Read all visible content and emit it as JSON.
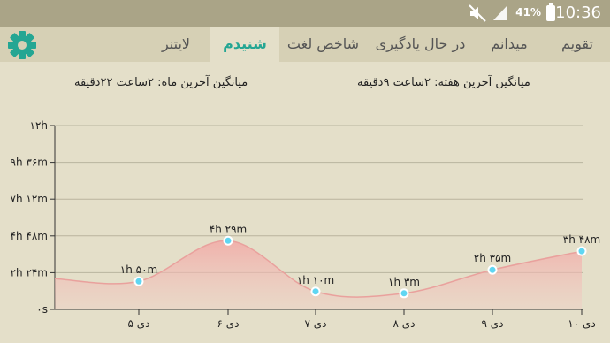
{
  "status": {
    "time": "10:36",
    "battery": "41%",
    "icons": [
      "mute-icon",
      "signal-icon",
      "battery-icon"
    ]
  },
  "tabs": [
    {
      "label": "تقویم",
      "active": false
    },
    {
      "label": "میدانم",
      "active": false
    },
    {
      "label": "در حال یادگیری",
      "active": false
    },
    {
      "label": "شاخص لغت",
      "active": false
    },
    {
      "label": "شنیدم",
      "active": true
    },
    {
      "label": "لایتنر",
      "active": false
    }
  ],
  "settings_icon": "gear-icon",
  "summary": {
    "week": "میانگین آخرین هفته: ۲ساعت  ۹دقیقه",
    "month": "میانگین آخرین ماه: ۲ساعت  ۲۲دقیقه"
  },
  "colors": {
    "accent": "#24a693",
    "area": "#f0b8b4",
    "point": "#5fd6f2"
  },
  "chart_data": {
    "type": "area",
    "x": [
      "۵ دی",
      "۶ دی",
      "۷ دی",
      "۸ دی",
      "۹ دی",
      "۱۰ دی"
    ],
    "y_ticks": [
      "۰s",
      "۲h ۲۴m",
      "۴h ۴۸m",
      "۷h ۱۲m",
      "۹h ۳۶m",
      "۱۲h"
    ],
    "ylim_minutes": [
      0,
      720
    ],
    "values_minutes": [
      110,
      269,
      70,
      63,
      155,
      228
    ],
    "point_labels": [
      "۱h ۵۰m",
      "۴h ۲۹m",
      "۱h ۱۰m",
      "۱h ۳m",
      "۲h ۳۵m",
      "۳h ۴۸m"
    ],
    "grid": true
  }
}
